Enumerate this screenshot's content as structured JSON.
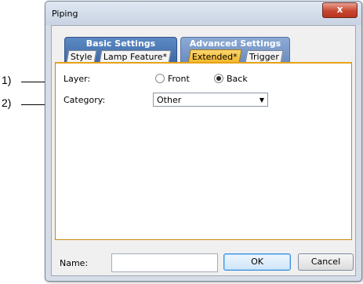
{
  "callouts": [
    {
      "label": "1)"
    },
    {
      "label": "2)"
    }
  ],
  "window": {
    "title": "Piping",
    "close_glyph": "x"
  },
  "tabs": {
    "basic": {
      "label": "Basic Settings",
      "subtabs": [
        "Style",
        "Lamp Feature*"
      ]
    },
    "advanced": {
      "label": "Advanced Settings",
      "subtabs": [
        "Extended*",
        "Trigger"
      ],
      "active": "Extended*"
    }
  },
  "form": {
    "layer": {
      "label": "Layer:",
      "options": [
        "Front",
        "Back"
      ],
      "selected": "Back"
    },
    "category": {
      "label": "Category:",
      "value": "Other"
    }
  },
  "footer": {
    "name_label": "Name:",
    "name_value": "",
    "ok_label": "OK",
    "cancel_label": "Cancel"
  }
}
